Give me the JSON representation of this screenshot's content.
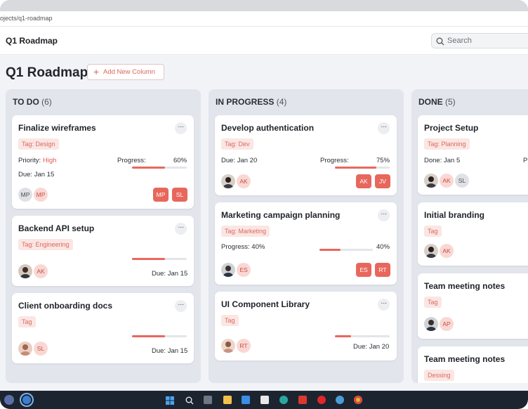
{
  "browser": {
    "url": "ojects/q1-roadmap"
  },
  "header": {
    "app_title": "Q1 Roadmap",
    "search_placeholder": "Search"
  },
  "page": {
    "title": "Q1 Roadmap",
    "add_column_label": "Add New Column"
  },
  "colors": {
    "accent": "#e8675c",
    "tag_bg": "#fbe6e3",
    "tag_text": "#d96a5f",
    "column_bg": "#e2e5eb"
  },
  "columns": [
    {
      "name": "TO DO",
      "count": "(6)",
      "cards": [
        {
          "title": "Finalize wireframes",
          "tag": "Tag:  Design",
          "priority_label": "Priority:",
          "priority_value": "High",
          "progress_label": "Progress:",
          "progress_text": "60%",
          "progress": 0.6,
          "due": "Due: Jan 15",
          "avatars": [
            "MP",
            "MP"
          ],
          "chips": [
            "MP",
            "SL"
          ]
        },
        {
          "title": "Backend API setup",
          "tag": "Tag:  Engineering",
          "progress": 0.6,
          "due": "Due: Jan 15",
          "avatars": [
            "",
            "AK"
          ]
        },
        {
          "title": "Client onboarding docs",
          "tag": "Tag",
          "progress": 0.6,
          "due": "Due: Jan 15",
          "avatars": [
            "",
            "SL"
          ]
        }
      ]
    },
    {
      "name": "IN PROGRESS",
      "count": "(4)",
      "cards": [
        {
          "title": "Develop authentication",
          "tag": "Tag:  Dev",
          "due": "Due: Jan 20",
          "progress_label": "Progress:",
          "progress_text": "75%",
          "progress": 0.75,
          "avatars": [
            "",
            "AK"
          ],
          "chips": [
            "AK",
            "JV"
          ]
        },
        {
          "title": "Marketing campaign planning",
          "tag": "Tag:  Marketing",
          "progress_left": "Progress: 40%",
          "progress_text": "40%",
          "progress": 0.4,
          "avatars": [
            "",
            "ES"
          ],
          "chips": [
            "ES",
            "RT"
          ]
        },
        {
          "title": "UI Component Library",
          "tag": "Tag",
          "progress": 0.3,
          "due": "Due: Jan 20",
          "avatars": [
            "",
            "RT"
          ]
        }
      ]
    },
    {
      "name": "DONE",
      "count": "(5)",
      "cards": [
        {
          "title": "Project Setup",
          "tag": "Tag:  Planning",
          "done": "Done: Jan 5",
          "cut_label": "P",
          "avatars": [
            "",
            "AK",
            "SL"
          ]
        },
        {
          "title": "Initial branding",
          "tag": "Tag",
          "avatars": [
            "",
            "AK"
          ]
        },
        {
          "title": "Team meeting notes",
          "tag": "Tag",
          "avatars": [
            "",
            "AP"
          ]
        },
        {
          "title": "Team meeting notes",
          "tag": "Dessing"
        }
      ]
    }
  ],
  "taskbar": {
    "icons": [
      "windows-start-icon",
      "search-icon",
      "task-view-icon",
      "file-explorer-icon",
      "mail-icon",
      "store-icon",
      "edge-icon",
      "pdf-icon",
      "opera-icon",
      "app-icon",
      "chrome-icon"
    ]
  }
}
